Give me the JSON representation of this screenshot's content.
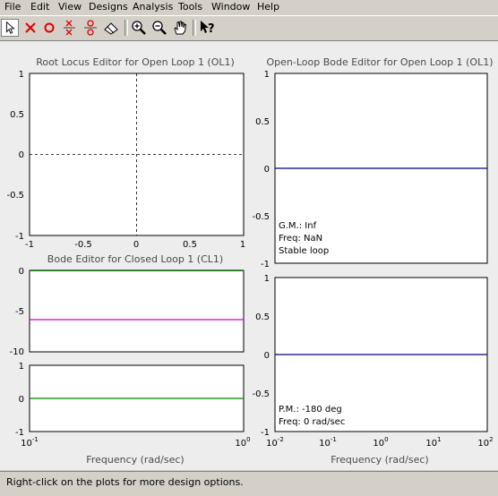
{
  "menu": [
    "File",
    "Edit",
    "View",
    "Designs",
    "Analysis",
    "Tools",
    "Window",
    "Help"
  ],
  "toolbar": {
    "icons": [
      "select-arrow-icon",
      "add-pole-icon",
      "add-zero-icon",
      "add-complex-pole-icon",
      "add-complex-zero-icon",
      "eraser-icon",
      "zoom-in-icon",
      "zoom-out-icon",
      "pan-hand-icon",
      "context-help-icon"
    ]
  },
  "plots": {
    "root_locus": {
      "title": "Root Locus Editor for Open Loop 1 (OL1)",
      "yticks": [
        "1",
        "0.5",
        "0",
        "-0.5",
        "-1"
      ],
      "xticks": [
        "-1",
        "-0.5",
        "0",
        "0.5",
        "1"
      ],
      "xlim": [
        -1,
        1
      ],
      "ylim": [
        -1,
        1
      ]
    },
    "closed_loop_bode": {
      "title": "Bode Editor for Closed Loop 1 (CL1)",
      "mag_yticks": [
        "0",
        "-5",
        "-10"
      ],
      "phase_yticks": [
        "1",
        "0",
        "-1"
      ],
      "xticks": [
        {
          "base": "10",
          "exp": "-1"
        },
        {
          "base": "10",
          "exp": "0"
        }
      ],
      "xlabel": "Frequency (rad/sec)",
      "mag_value_db": -6,
      "phase_value": 0
    },
    "open_loop_bode": {
      "title": "Open-Loop Bode Editor for Open Loop 1 (OL1)",
      "mag_yticks": [
        "1",
        "0.5",
        "0",
        "-0.5",
        "-1"
      ],
      "phase_yticks": [
        "1",
        "0.5",
        "0",
        "-0.5",
        "-1"
      ],
      "xticks": [
        {
          "base": "10",
          "exp": "-2"
        },
        {
          "base": "10",
          "exp": "-1"
        },
        {
          "base": "10",
          "exp": "0"
        },
        {
          "base": "10",
          "exp": "1"
        },
        {
          "base": "10",
          "exp": "2"
        }
      ],
      "xlabel": "Frequency (rad/sec)",
      "gm_label": "G.M.: Inf",
      "freq_label_1": "Freq: NaN",
      "stability_label": "Stable loop",
      "pm_label": "P.M.: -180 deg",
      "freq_label_2": "Freq: 0 rad/sec"
    }
  },
  "colors": {
    "mag_line": "#cc00cc",
    "green_line": "#008000",
    "open_loop_line": "#000080"
  },
  "status": "Right-click on the plots for more design options."
}
